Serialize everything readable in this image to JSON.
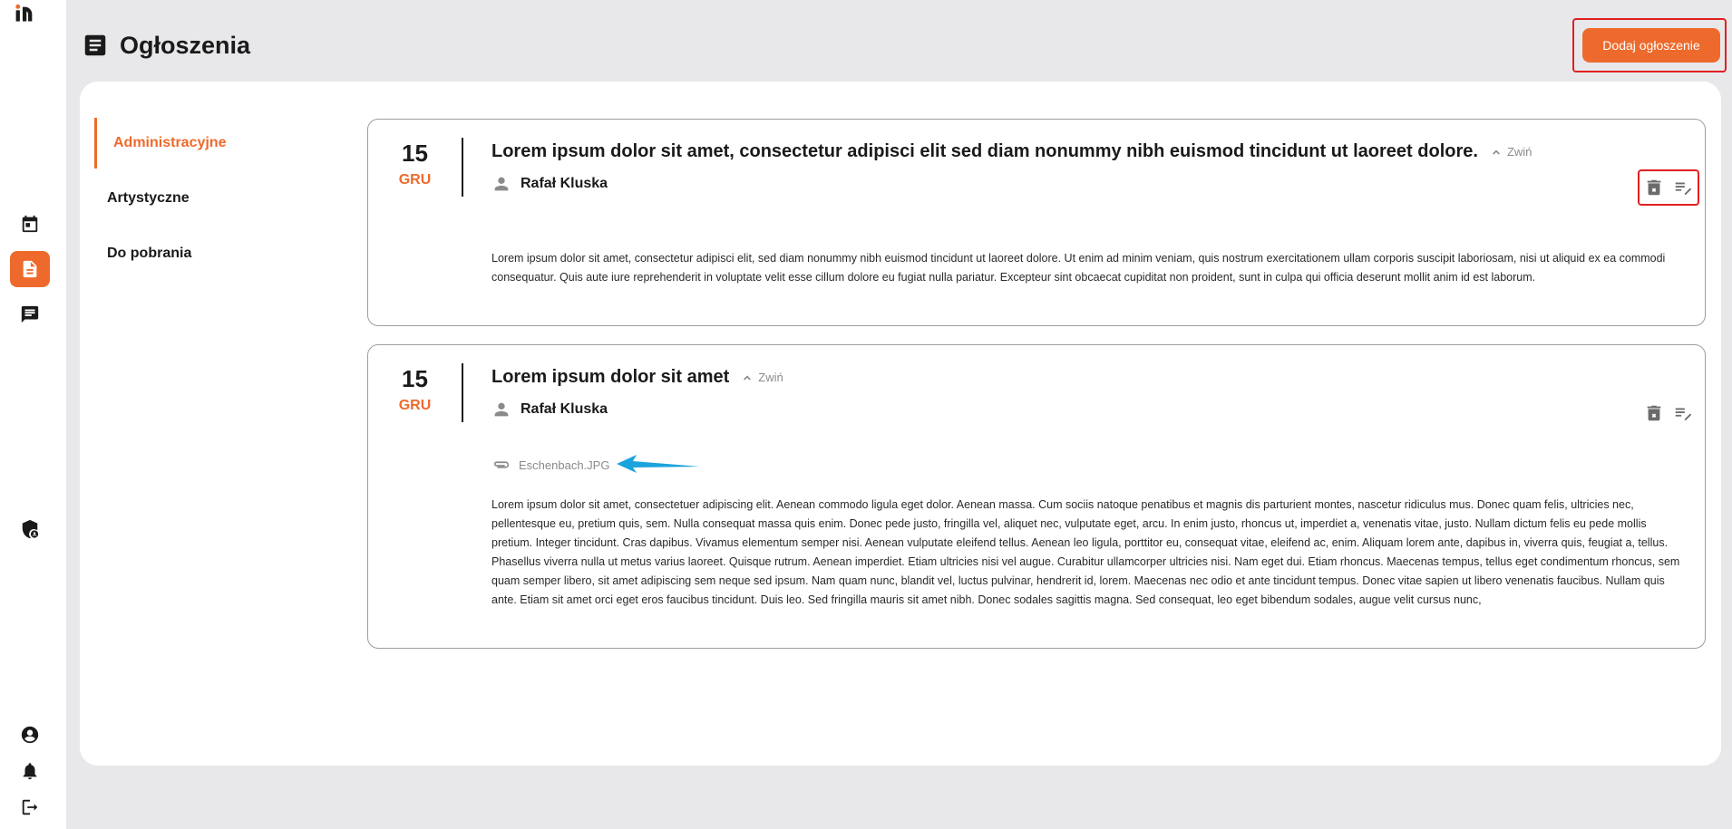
{
  "header": {
    "title": "Ogłoszenia",
    "add_button": "Dodaj ogłoszenie"
  },
  "rail": {
    "icons": [
      "logo",
      "calendar-icon",
      "announcements-icon",
      "chat-icon",
      "security-icon",
      "account-icon",
      "bell-icon",
      "logout-icon"
    ],
    "active": "announcements-icon"
  },
  "categories": [
    {
      "label": "Administracyjne",
      "active": true
    },
    {
      "label": "Artystyczne",
      "active": false
    },
    {
      "label": "Do pobrania",
      "active": false
    }
  ],
  "posts": [
    {
      "day": "15",
      "month": "GRU",
      "title": "Lorem ipsum dolor sit amet, consectetur adipisci elit sed diam nonummy nibh euismod tincidunt ut laoreet dolore.",
      "collapse_label": "Zwiń",
      "author": "Rafał Kluska",
      "body": "Lorem ipsum dolor sit amet, consectetur adipisci elit, sed diam nonummy nibh euismod tincidunt ut laoreet dolore. Ut enim ad minim veniam, quis nostrum exercitationem ullam corporis suscipit laboriosam, nisi ut aliquid ex ea commodi consequatur. Quis aute iure reprehenderit in voluptate velit esse cillum dolore eu fugiat nulla pariatur. Excepteur sint obcaecat cupiditat non proident, sunt in culpa qui officia deserunt mollit anim id est laborum."
    },
    {
      "day": "15",
      "month": "GRU",
      "title": "Lorem ipsum dolor sit amet",
      "collapse_label": "Zwiń",
      "author": "Rafał Kluska",
      "attachment": "Eschenbach.JPG",
      "body": "Lorem ipsum dolor sit amet, consectetuer adipiscing elit. Aenean commodo ligula eget dolor. Aenean massa. Cum sociis natoque penatibus et magnis dis parturient montes, nascetur ridiculus mus. Donec quam felis, ultricies nec, pellentesque eu, pretium quis, sem. Nulla consequat massa quis enim. Donec pede justo, fringilla vel, aliquet nec, vulputate eget, arcu. In enim justo, rhoncus ut, imperdiet a, venenatis vitae, justo. Nullam dictum felis eu pede mollis pretium. Integer tincidunt. Cras dapibus. Vivamus elementum semper nisi. Aenean vulputate eleifend tellus. Aenean leo ligula, porttitor eu, consequat vitae, eleifend ac, enim. Aliquam lorem ante, dapibus in, viverra quis, feugiat a, tellus. Phasellus viverra nulla ut metus varius laoreet. Quisque rutrum. Aenean imperdiet. Etiam ultricies nisi vel augue. Curabitur ullamcorper ultricies nisi. Nam eget dui. Etiam rhoncus. Maecenas tempus, tellus eget condimentum rhoncus, sem quam semper libero, sit amet adipiscing sem neque sed ipsum. Nam quam nunc, blandit vel, luctus pulvinar, hendrerit id, lorem. Maecenas nec odio et ante tincidunt tempus. Donec vitae sapien ut libero venenatis faucibus. Nullam quis ante. Etiam sit amet orci eget eros faucibus tincidunt. Duis leo. Sed fringilla mauris sit amet nibh. Donec sodales sagittis magna. Sed consequat, leo eget bibendum sodales, augue velit cursus nunc,"
    }
  ],
  "colors": {
    "accent": "#ee6a2c",
    "highlight": "#e02020",
    "annotation_arrow": "#1aa3dc",
    "background": "#e8e8eb"
  }
}
